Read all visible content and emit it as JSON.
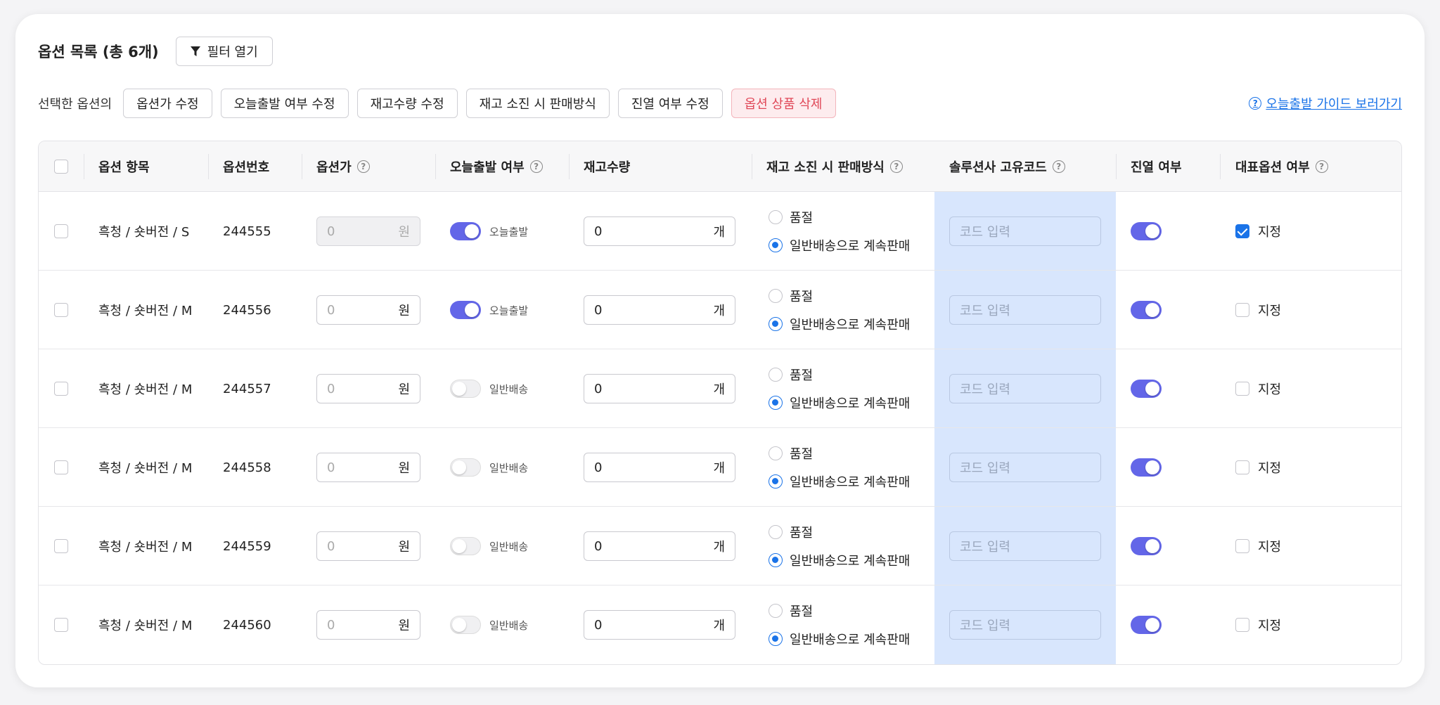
{
  "header": {
    "title": "옵션 목록 (총 6개)",
    "filter_label": "필터 열기",
    "filter_icon": "funnel-icon"
  },
  "actions": {
    "label": "선택한 옵션의",
    "buttons": [
      "옵션가 수정",
      "오늘출발 여부 수정",
      "재고수량 수정",
      "재고 소진 시 판매방식",
      "진열 여부 수정",
      "옵션 상품 삭제"
    ],
    "guide_link": "오늘출발 가이드 보러가기"
  },
  "columns": [
    "옵션 항목",
    "옵션번호",
    "옵션가",
    "오늘출발 여부",
    "재고수량",
    "재고 소진 시 판매방식",
    "솔루션사 고유코드",
    "진열 여부",
    "대표옵션 여부"
  ],
  "help_icon": "?",
  "colors": {
    "accent": "#1a73e8",
    "toggle_on": "#6366e8",
    "danger": "#e04858",
    "code_band": "#d8e6fd"
  },
  "rows": [
    {
      "name": "흑청 / 숏버전 / S",
      "number": "244555",
      "price_placeholder": "0",
      "price_unit": "원",
      "price_disabled": true,
      "today_ship": true,
      "today_label": "오늘출발",
      "stock": "0",
      "stock_unit": "개",
      "sold_out_label": "품절",
      "continue_label": "일반배송으로 계속판매",
      "selected_mode": "continue",
      "code_placeholder": "코드 입력",
      "display": true,
      "representative": true,
      "rep_label": "지정"
    },
    {
      "name": "흑청 / 숏버전 / M",
      "number": "244556",
      "price_placeholder": "0",
      "price_unit": "원",
      "price_disabled": false,
      "today_ship": true,
      "today_label": "오늘출발",
      "stock": "0",
      "stock_unit": "개",
      "sold_out_label": "품절",
      "continue_label": "일반배송으로 계속판매",
      "selected_mode": "continue",
      "code_placeholder": "코드 입력",
      "display": true,
      "representative": false,
      "rep_label": "지정"
    },
    {
      "name": "흑청 / 숏버전 / M",
      "number": "244557",
      "price_placeholder": "0",
      "price_unit": "원",
      "price_disabled": false,
      "today_ship": false,
      "today_label": "일반배송",
      "stock": "0",
      "stock_unit": "개",
      "sold_out_label": "품절",
      "continue_label": "일반배송으로 계속판매",
      "selected_mode": "continue",
      "code_placeholder": "코드 입력",
      "display": true,
      "representative": false,
      "rep_label": "지정"
    },
    {
      "name": "흑청 / 숏버전 / M",
      "number": "244558",
      "price_placeholder": "0",
      "price_unit": "원",
      "price_disabled": false,
      "today_ship": false,
      "today_label": "일반배송",
      "stock": "0",
      "stock_unit": "개",
      "sold_out_label": "품절",
      "continue_label": "일반배송으로 계속판매",
      "selected_mode": "continue",
      "code_placeholder": "코드 입력",
      "display": true,
      "representative": false,
      "rep_label": "지정"
    },
    {
      "name": "흑청 / 숏버전 / M",
      "number": "244559",
      "price_placeholder": "0",
      "price_unit": "원",
      "price_disabled": false,
      "today_ship": false,
      "today_label": "일반배송",
      "stock": "0",
      "stock_unit": "개",
      "sold_out_label": "품절",
      "continue_label": "일반배송으로 계속판매",
      "selected_mode": "continue",
      "code_placeholder": "코드 입력",
      "display": true,
      "representative": false,
      "rep_label": "지정"
    },
    {
      "name": "흑청 / 숏버전 / M",
      "number": "244560",
      "price_placeholder": "0",
      "price_unit": "원",
      "price_disabled": false,
      "today_ship": false,
      "today_label": "일반배송",
      "stock": "0",
      "stock_unit": "개",
      "sold_out_label": "품절",
      "continue_label": "일반배송으로 계속판매",
      "selected_mode": "continue",
      "code_placeholder": "코드 입력",
      "display": true,
      "representative": false,
      "rep_label": "지정"
    }
  ]
}
